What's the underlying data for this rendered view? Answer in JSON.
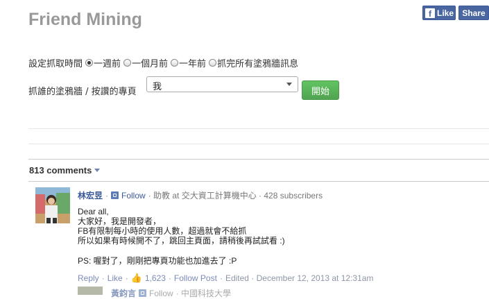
{
  "app": {
    "title": "Friend Mining"
  },
  "header": {
    "like_label": "Like",
    "share_label": "Share",
    "fb_letter": "f"
  },
  "form": {
    "time_label": "設定抓取時間",
    "time_options": [
      {
        "label": "一週前",
        "selected": true
      },
      {
        "label": "一個月前",
        "selected": false
      },
      {
        "label": "一年前",
        "selected": false
      },
      {
        "label": "抓完所有塗鴉牆訊息",
        "selected": false
      }
    ],
    "wall_label": "抓誰的塗鴉牆 / 按讚的專頁",
    "wall_select_value": "我",
    "start_button": "開始"
  },
  "comments": {
    "count_label": "813 comments",
    "items": [
      {
        "author": "林宏昱",
        "follow": "Follow",
        "meta": "· 助教 at 交大資工計算機中心 · 428 subscribers",
        "body_lines": [
          "Dear all,",
          "大家好，我是開發者，",
          "FB有限制每小時的使用人數，超過就會不給抓",
          "所以如果有時候開不了，跳回主頁面，請稍後再試試看 :)"
        ],
        "ps": "PS: 喔對了，剛剛把專頁功能也加進去了 :P",
        "reply": "Reply",
        "like": "Like",
        "like_count": "1,623",
        "follow_post": "Follow Post",
        "edited": "Edited · December 12, 2013 at 12:31am"
      },
      {
        "author": "黃鈞言",
        "follow": "Follow",
        "meta": "· 中國科技大學"
      }
    ]
  },
  "colors": {
    "accent": "#3b5998",
    "start_green": "#5cb85c",
    "title_gray": "#999999"
  }
}
